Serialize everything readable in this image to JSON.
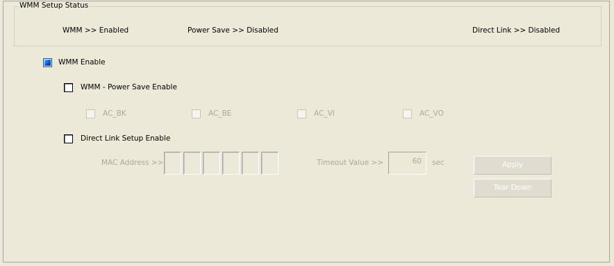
{
  "wmm_status": {
    "title": "WMM Setup Status",
    "wmm": "WMM >> Enabled",
    "power_save": "Power Save >> Disabled",
    "direct_link": "Direct Link >> Disabled"
  },
  "wmm_enable": {
    "label": "WMM Enable",
    "checked": true
  },
  "power_save_enable": {
    "label": "WMM - Power Save Enable",
    "checked": false
  },
  "access_categories": [
    {
      "label": "AC_BK",
      "checked": false
    },
    {
      "label": "AC_BE",
      "checked": false
    },
    {
      "label": "AC_VI",
      "checked": false
    },
    {
      "label": "AC_VO",
      "checked": false
    }
  ],
  "direct_link_setup": {
    "label": "Direct Link Setup Enable",
    "checked": false,
    "mac_label": "MAC Address >>",
    "mac_octets": [
      "",
      "",
      "",
      "",
      "",
      ""
    ],
    "timeout_label": "Timeout Value >>",
    "timeout_value": "60",
    "timeout_unit": "sec"
  },
  "buttons": {
    "apply": "Apply",
    "tear_down": "Tear Down"
  }
}
